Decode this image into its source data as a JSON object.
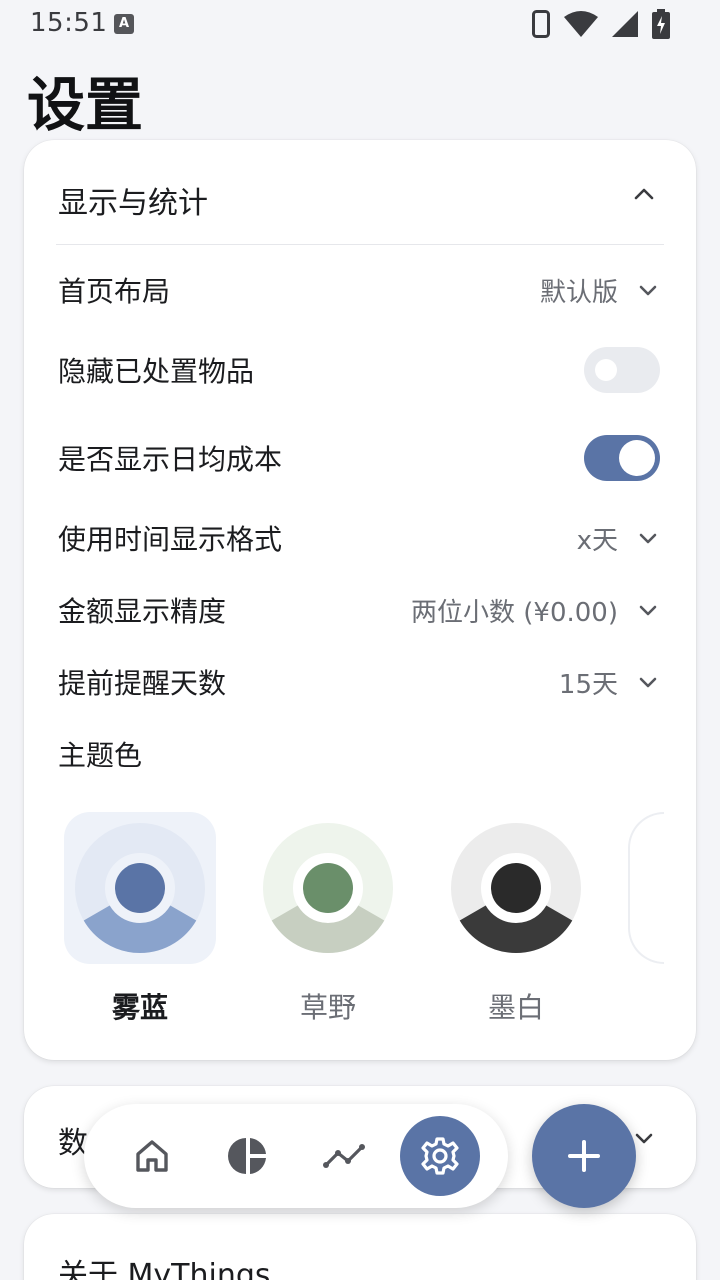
{
  "status_bar": {
    "time": "15:51",
    "notification_badge": "A"
  },
  "page_title": "设置",
  "display_section": {
    "title": "显示与统计",
    "rows": {
      "home_layout": {
        "label": "首页布局",
        "value": "默认版"
      },
      "hide_disposed": {
        "label": "隐藏已处置物品",
        "enabled": false
      },
      "show_daily_cost": {
        "label": "是否显示日均成本",
        "enabled": true
      },
      "time_format": {
        "label": "使用时间显示格式",
        "value": "x天"
      },
      "amount_precision": {
        "label": "金额显示精度",
        "value": "两位小数 (¥0.00)"
      },
      "reminder_days": {
        "label": "提前提醒天数",
        "value": "15天"
      }
    },
    "theme": {
      "label": "主题色",
      "options": [
        {
          "name": "雾蓝",
          "selected": true,
          "accent": "#5a74a6"
        },
        {
          "name": "草野",
          "selected": false,
          "accent": "#6a8f6a"
        },
        {
          "name": "墨白",
          "selected": false,
          "accent": "#2a2a2a"
        }
      ]
    }
  },
  "data_section": {
    "title": "数"
  },
  "about_section": {
    "title": "关于 MyThings"
  },
  "colors": {
    "accent": "#5a74a6",
    "background": "#f4f5f8",
    "card": "#ffffff"
  },
  "icons": [
    "home-icon",
    "chart-pie-icon",
    "trend-line-icon",
    "gear-icon",
    "plus-icon"
  ]
}
